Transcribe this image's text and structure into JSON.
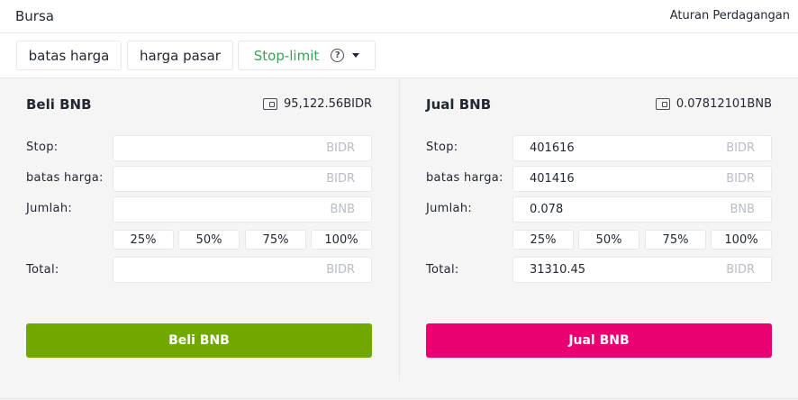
{
  "header": {
    "title": "Bursa",
    "rules_link": "Aturan Perdagangan"
  },
  "tabs": {
    "limit": "batas harga",
    "market": "harga pasar",
    "stop_limit": "Stop-limit",
    "help_glyph": "?"
  },
  "colors": {
    "active_tab": "#3aa35a",
    "buy": "#70a800",
    "sell": "#ea0070"
  },
  "buy": {
    "title": "Beli BNB",
    "balance": "95,122.56BIDR",
    "labels": {
      "stop": "Stop:",
      "price": "batas harga:",
      "amount": "Jumlah:",
      "total": "Total:"
    },
    "stop": {
      "value": "",
      "unit": "BIDR"
    },
    "price": {
      "value": "",
      "unit": "BIDR"
    },
    "amount": {
      "value": "",
      "unit": "BNB"
    },
    "total": {
      "value": "",
      "unit": "BIDR"
    },
    "percents": [
      "25%",
      "50%",
      "75%",
      "100%"
    ],
    "button": "Beli BNB"
  },
  "sell": {
    "title": "Jual BNB",
    "balance": "0.07812101BNB",
    "labels": {
      "stop": "Stop:",
      "price": "batas harga:",
      "amount": "Jumlah:",
      "total": "Total:"
    },
    "stop": {
      "value": "401616",
      "unit": "BIDR"
    },
    "price": {
      "value": "401416",
      "unit": "BIDR"
    },
    "amount": {
      "value": "0.078",
      "unit": "BNB"
    },
    "total": {
      "value": "31310.45",
      "unit": "BIDR"
    },
    "percents": [
      "25%",
      "50%",
      "75%",
      "100%"
    ],
    "button": "Jual BNB"
  },
  "icons": {
    "wallet": "wallet-icon",
    "help": "help-circle-icon",
    "caret": "caret-down-icon"
  }
}
